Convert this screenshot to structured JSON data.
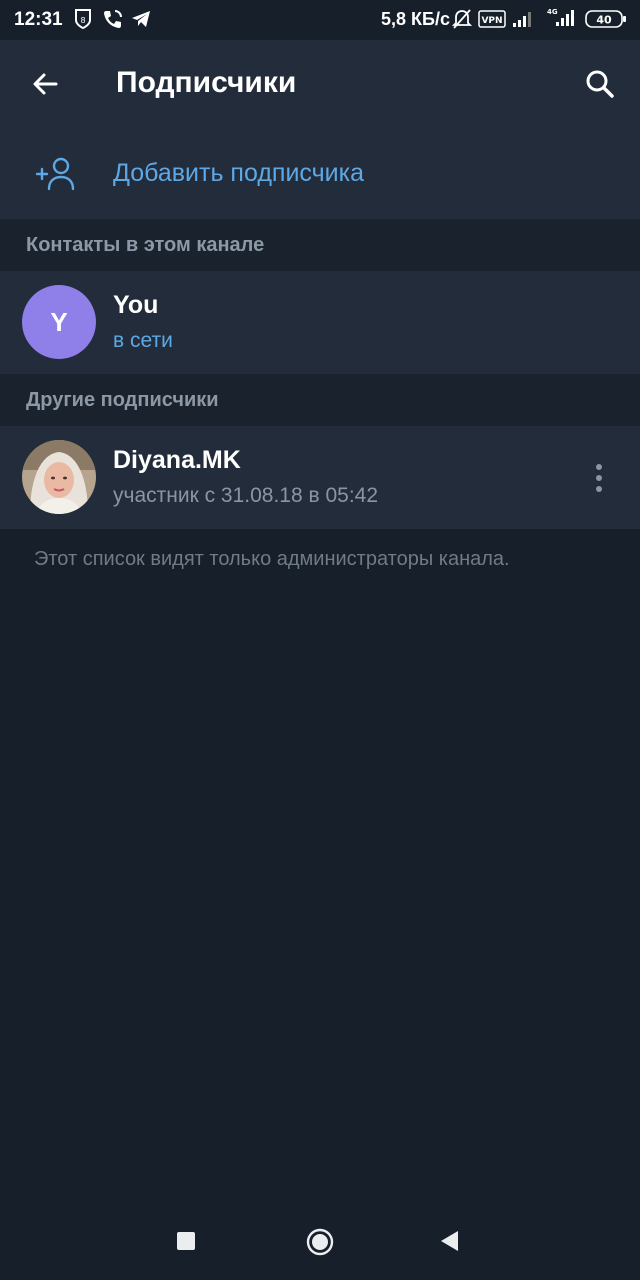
{
  "status_bar": {
    "time": "12:31",
    "speed": "5,8 КБ/с",
    "vpn": "VPN",
    "network": "4G",
    "battery": "40"
  },
  "toolbar": {
    "title": "Подписчики"
  },
  "add_subscriber": {
    "label": "Добавить подписчика"
  },
  "sections": [
    {
      "header": "Контакты в этом канале",
      "members": [
        {
          "avatar_letter": "Y",
          "avatar_color": "#8e7fe9",
          "name": "You",
          "status": "в сети",
          "status_type": "online"
        }
      ]
    },
    {
      "header": "Другие подписчики",
      "members": [
        {
          "name": "Diyana.MK",
          "status": "участник с 31.08.18 в 05:42",
          "status_type": "offline",
          "avatar_type": "photo"
        }
      ]
    }
  ],
  "footer_note": "Этот список видят только администраторы канала.",
  "colors": {
    "background": "#171f2a",
    "surface": "#222c3a",
    "accent": "#5ea8e6",
    "secondary_text": "#8a96a4"
  },
  "icons": [
    "back-arrow-icon",
    "search-icon",
    "add-user-icon",
    "more-vert-icon",
    "recent-apps-icon",
    "home-icon",
    "back-nav-icon"
  ]
}
